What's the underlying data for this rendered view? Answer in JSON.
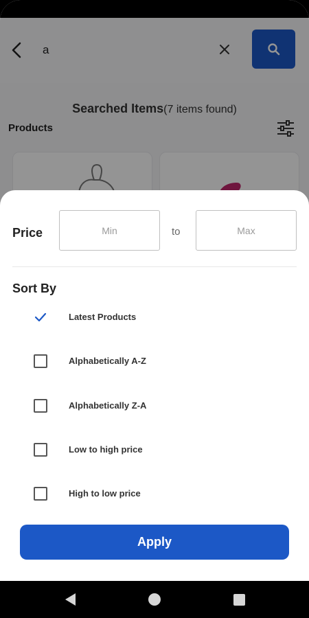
{
  "search": {
    "query": "a"
  },
  "results": {
    "title": "Searched Items",
    "count_text": "(7 items found)",
    "products_label": "Products"
  },
  "filter": {
    "price_label": "Price",
    "min_placeholder": "Min",
    "to_label": "to",
    "max_placeholder": "Max",
    "sort_label": "Sort By",
    "options": [
      {
        "label": "Latest Products",
        "selected": true
      },
      {
        "label": "Alphabetically A-Z",
        "selected": false
      },
      {
        "label": "Alphabetically Z-A",
        "selected": false
      },
      {
        "label": "Low to high price",
        "selected": false
      },
      {
        "label": "High to low price",
        "selected": false
      }
    ],
    "apply_label": "Apply"
  },
  "colors": {
    "accent": "#1c58c6"
  },
  "icons": [
    "back-arrow-icon",
    "close-icon",
    "search-icon",
    "filter-sliders-icon",
    "check-icon",
    "nav-back-icon",
    "nav-home-icon",
    "nav-recent-icon"
  ]
}
